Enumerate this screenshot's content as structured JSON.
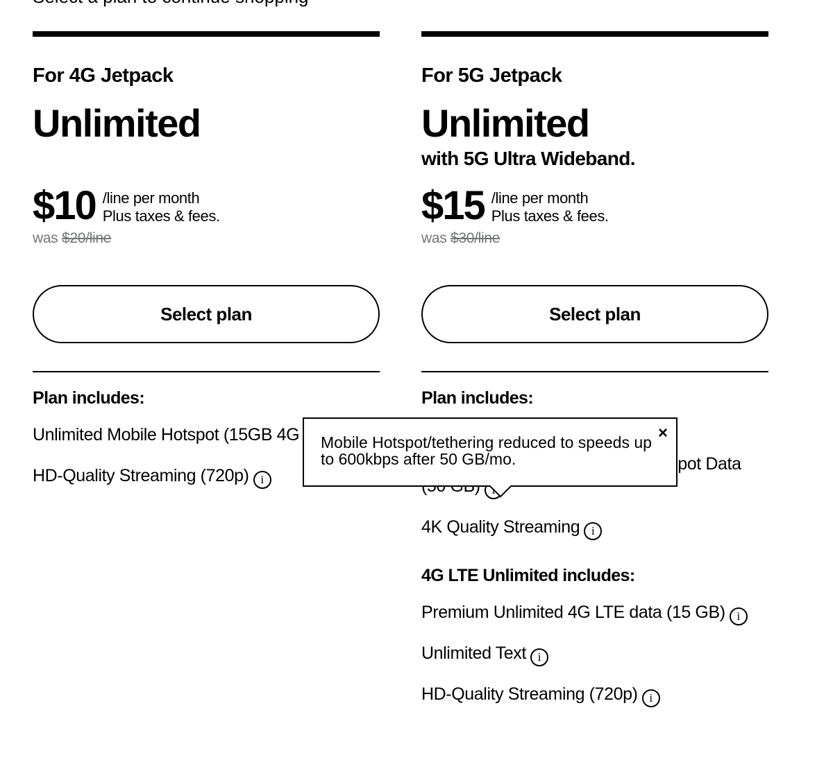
{
  "page": {
    "top_text": "Select a plan to continue shopping"
  },
  "plans": [
    {
      "for_label": "For 4G Jetpack",
      "name": "Unlimited",
      "subtitle": "",
      "price": "$10",
      "price_unit": "/line per month",
      "price_note": "Plus taxes & fees.",
      "was_label": "was",
      "was_price": "$20/line",
      "button_label": "Select plan",
      "includes_title": "Plan includes:",
      "features": [
        "Unlimited Mobile Hotspot (15GB 4G LTE)",
        "HD-Quality Streaming (720p)"
      ]
    },
    {
      "for_label": "For 5G Jetpack",
      "name": "Unlimited",
      "subtitle": "with 5G Ultra Wideband.",
      "price": "$15",
      "price_unit": "/line per month",
      "price_note": "Plus taxes & fees.",
      "was_label": "was",
      "was_price": "$30/line",
      "button_label": "Select plan",
      "includes_title": "Plan includes:",
      "features": [
        "Unlimited 5G Ultra Wideband Hotspot Data (50 GB)",
        "4K Quality Streaming"
      ],
      "lte_title": "4G LTE Unlimited includes:",
      "lte_features": [
        "Premium Unlimited 4G LTE data (15 GB)",
        "Unlimited Text",
        "HD-Quality Streaming (720p)"
      ]
    }
  ],
  "tooltip": {
    "text": "Mobile Hotspot/tethering reduced to speeds up to 600kbps after 50 GB/mo.",
    "close_symbol": "×"
  },
  "icons": {
    "info_glyph": "i"
  }
}
